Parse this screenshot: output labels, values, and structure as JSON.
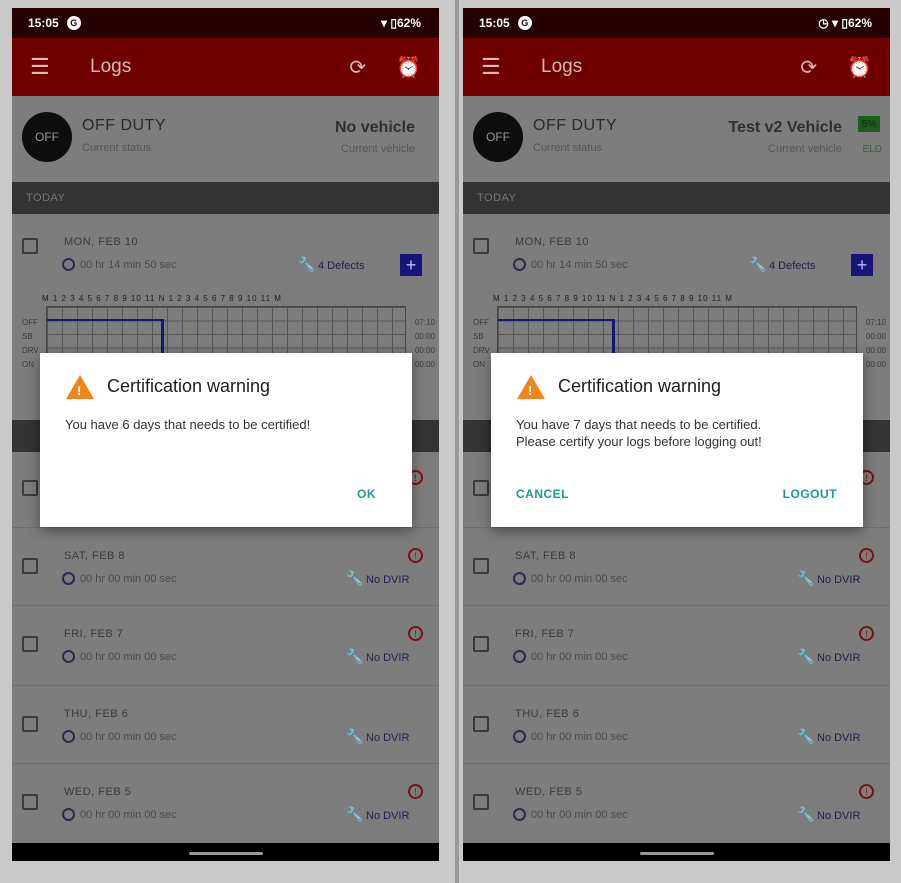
{
  "left": {
    "status_bar": {
      "time": "15:05",
      "app_icon": "G",
      "battery": "▾ ▯62%"
    },
    "toolbar": {
      "title": "Logs"
    },
    "duty": {
      "code": "OFF",
      "status": "OFF DUTY",
      "status_sub": "Current status"
    },
    "vehicle": {
      "name": "No vehicle",
      "sub": "Current vehicle"
    },
    "section": "TODAY",
    "today": {
      "day": "MON, FEB 10",
      "duration": "00 hr 14 min 50 sec",
      "defects": "4 Defects"
    },
    "hours_row": "M 1 2 3 4 5 6 7 8 9 10 11 N 1 2 3 4 5 6 7 8 9 10 11 M",
    "rows": [
      {
        "label": "OFF",
        "value": "07:10"
      },
      {
        "label": "SB",
        "value": "00:00"
      },
      {
        "label": "DRV",
        "value": "00:00"
      },
      {
        "label": "ON",
        "value": "00:00"
      }
    ],
    "logs": [
      {
        "day": "SAT, FEB 8",
        "duration": "00 hr 00 min 00 sec",
        "status": "No DVIR"
      },
      {
        "day": "FRI, FEB 7",
        "duration": "00 hr 00 min 00 sec",
        "status": "No DVIR"
      },
      {
        "day": "THU, FEB 6",
        "duration": "00 hr 00 min 00 sec",
        "status": "No DVIR"
      },
      {
        "day": "WED, FEB 5",
        "duration": "00 hr 00 min 00 sec",
        "status": "No DVIR"
      }
    ],
    "dialog": {
      "title": "Certification warning",
      "message": "You have 6 days that needs to be certified!",
      "ok": "OK"
    }
  },
  "right": {
    "status_bar": {
      "time": "15:05",
      "app_icon": "G",
      "battery": "◷ ▾ ▯62%"
    },
    "toolbar": {
      "title": "Logs"
    },
    "duty": {
      "code": "OFF",
      "status": "OFF DUTY",
      "status_sub": "Current status"
    },
    "vehicle": {
      "name": "Test v2 Vehicle",
      "sub": "Current vehicle",
      "badge": "5%",
      "badge_sub": "ELD"
    },
    "section": "TODAY",
    "today": {
      "day": "MON, FEB 10",
      "duration": "00 hr 14 min 50 sec",
      "defects": "4 Defects"
    },
    "hours_row": "M 1 2 3 4 5 6 7 8 9 10 11 N 1 2 3 4 5 6 7 8 9 10 11 M",
    "rows": [
      {
        "label": "OFF",
        "value": "07:10"
      },
      {
        "label": "SB",
        "value": "00:00"
      },
      {
        "label": "DRV",
        "value": "00:00"
      },
      {
        "label": "ON",
        "value": "00:00"
      }
    ],
    "logs": [
      {
        "day": "SAT, FEB 8",
        "duration": "00 hr 00 min 00 sec",
        "status": "No DVIR"
      },
      {
        "day": "FRI, FEB 7",
        "duration": "00 hr 00 min 00 sec",
        "status": "No DVIR"
      },
      {
        "day": "THU, FEB 6",
        "duration": "00 hr 00 min 00 sec",
        "status": "No DVIR"
      },
      {
        "day": "WED, FEB 5",
        "duration": "00 hr 00 min 00 sec",
        "status": "No DVIR"
      }
    ],
    "dialog": {
      "title": "Certification warning",
      "message": "You have 7 days that needs to be certified.",
      "message2": "Please certify your logs before logging out!",
      "cancel": "CANCEL",
      "logout": "LOGOUT"
    }
  }
}
